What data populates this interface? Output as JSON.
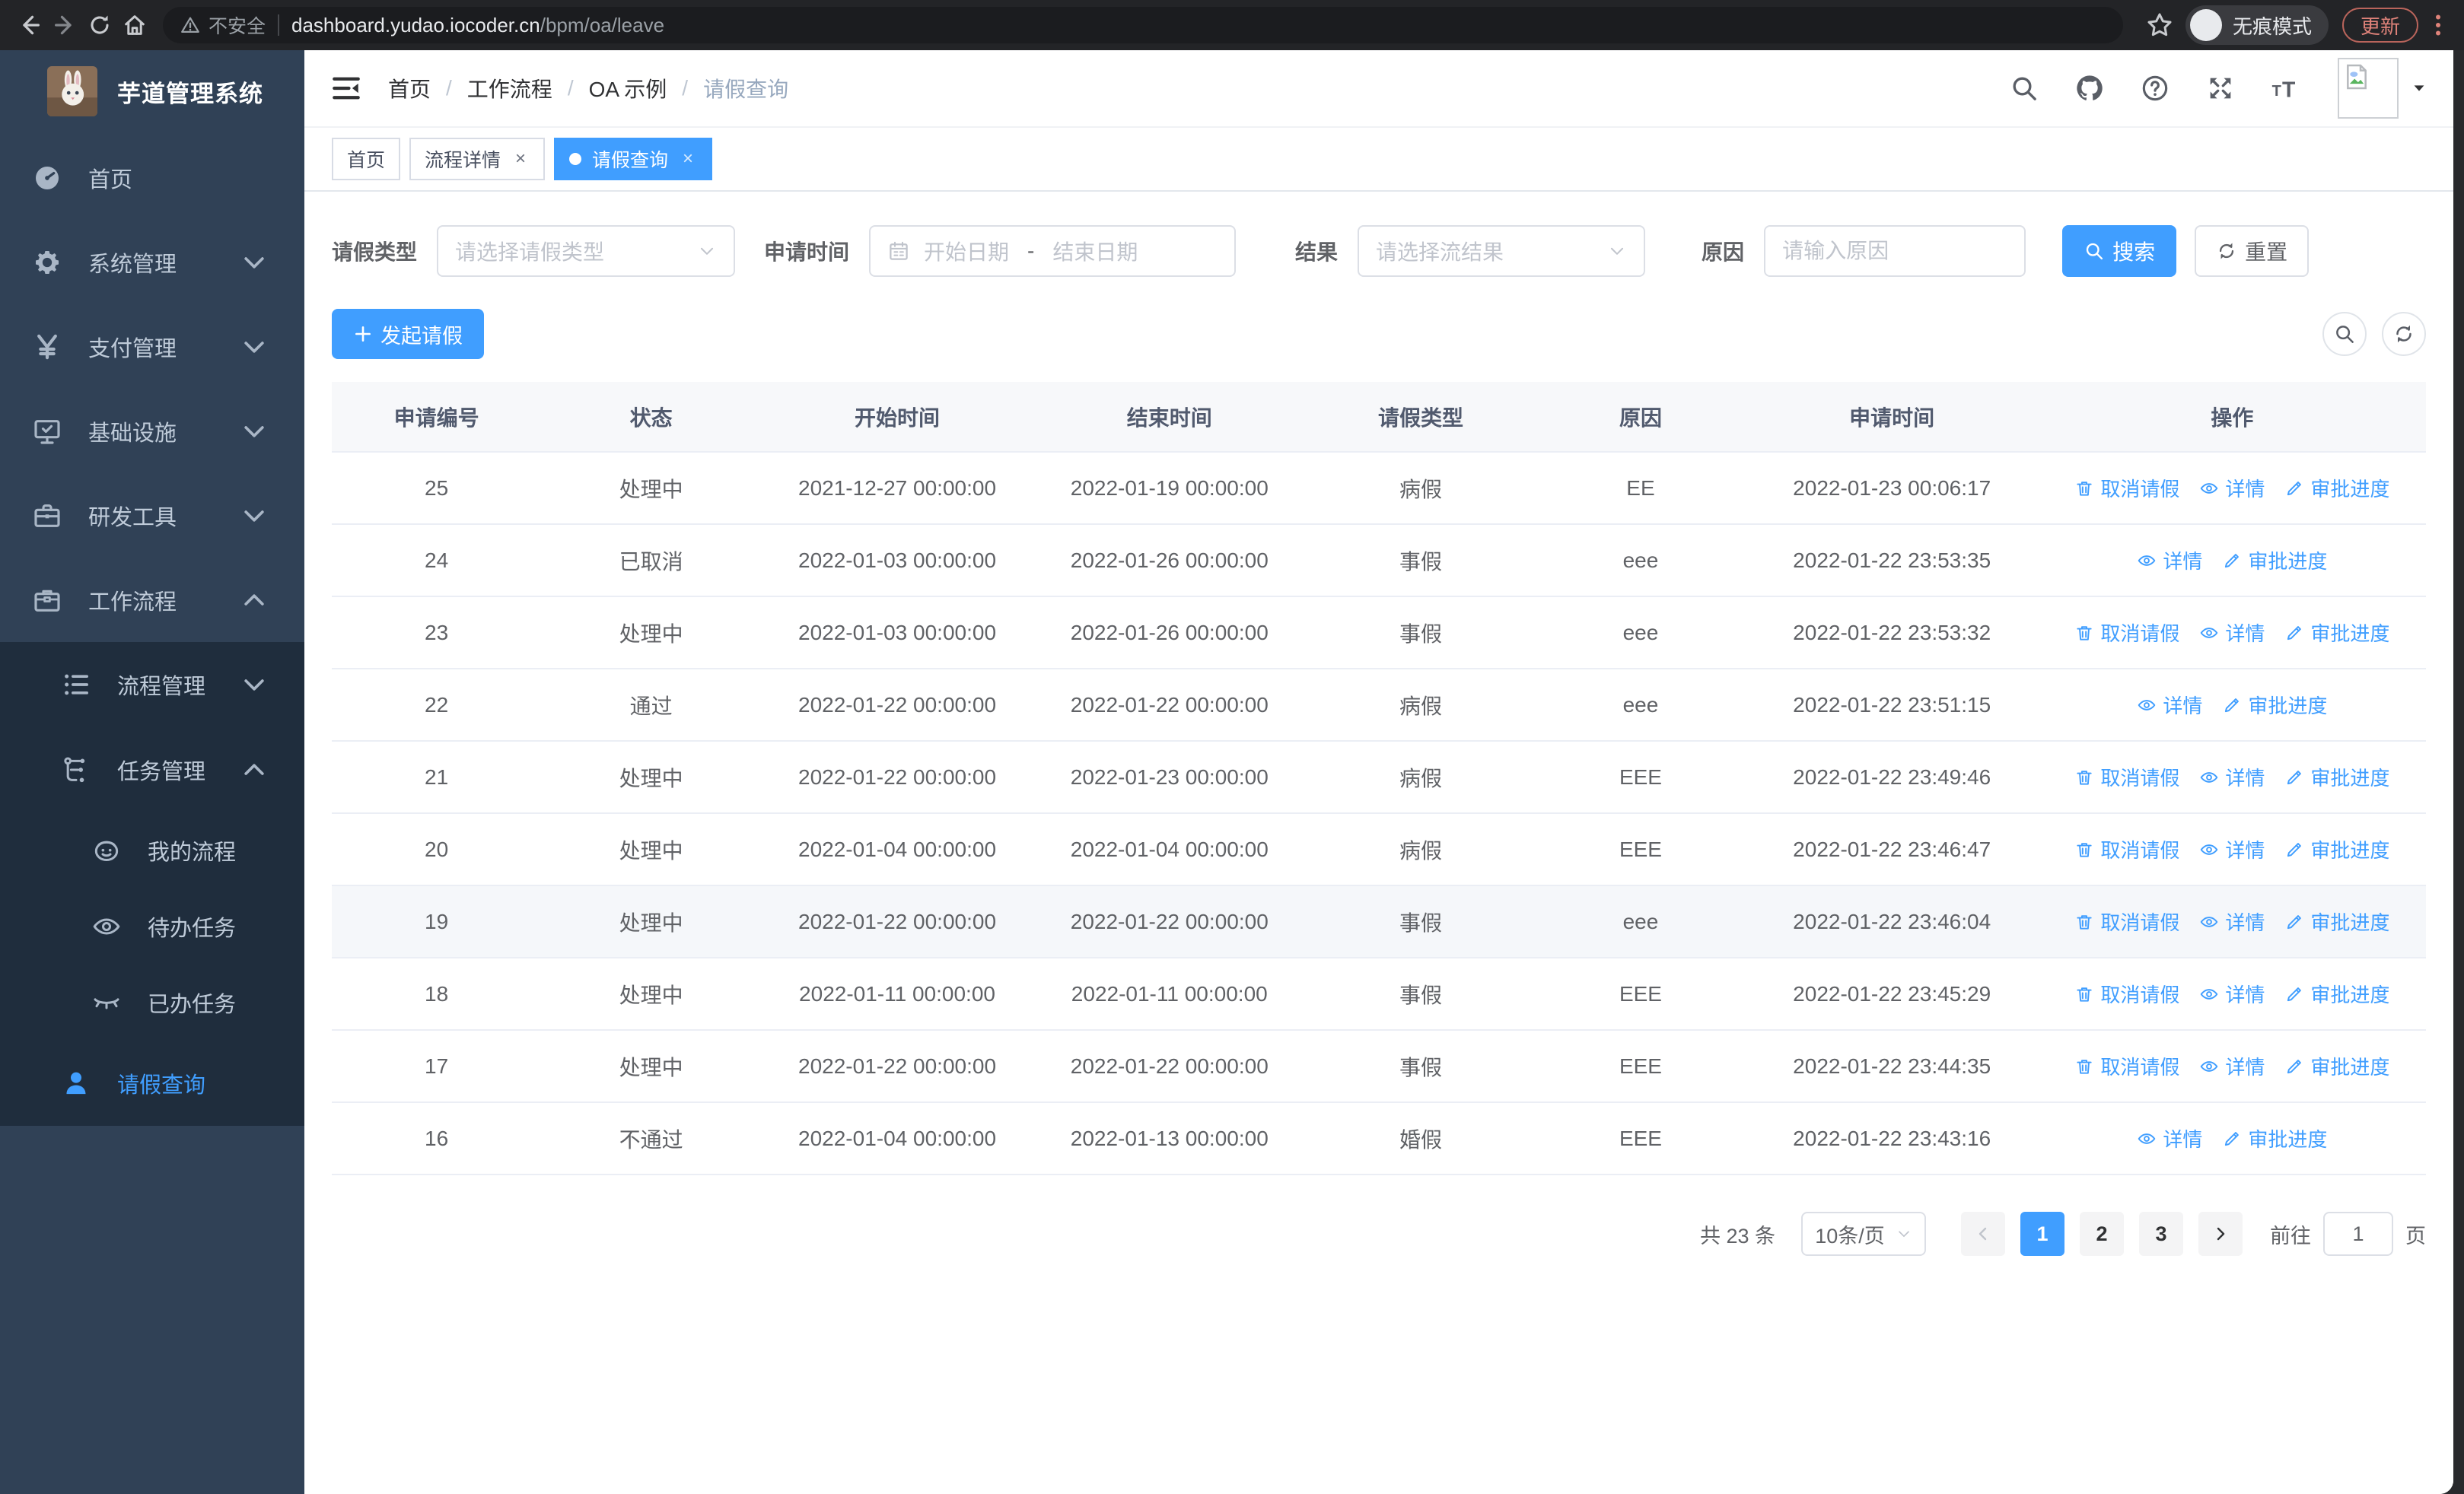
{
  "colors": {
    "primary": "#409eff",
    "sidebar_bg": "#304156",
    "submenu_bg": "#1f2d3d",
    "update_accent": "#e0837a"
  },
  "browser": {
    "security_label": "不安全",
    "url_host": "dashboard.yudao.iocoder.cn",
    "url_path": "/bpm/oa/leave",
    "incognito_label": "无痕模式",
    "update_label": "更新"
  },
  "sidebar": {
    "title": "芋道管理系统",
    "menu": [
      {
        "key": "home",
        "icon": "dashboard-icon",
        "label": "首页",
        "level": 1
      },
      {
        "key": "system-management",
        "icon": "gear-icon",
        "label": "系统管理",
        "level": 1,
        "chevron": "down"
      },
      {
        "key": "payment-management",
        "icon": "yen-icon",
        "label": "支付管理",
        "level": 1,
        "chevron": "down"
      },
      {
        "key": "infrastructure",
        "icon": "monitor-icon",
        "label": "基础设施",
        "level": 1,
        "chevron": "down"
      },
      {
        "key": "dev-tools",
        "icon": "toolbox-icon",
        "label": "研发工具",
        "level": 1,
        "chevron": "down"
      },
      {
        "key": "workflow",
        "icon": "briefcase-icon",
        "label": "工作流程",
        "level": 1,
        "chevron": "up"
      },
      {
        "key": "process-management",
        "icon": "tree-list-icon",
        "label": "流程管理",
        "level": 2,
        "chevron": "down",
        "submenu": true
      },
      {
        "key": "task-management",
        "icon": "flow-icon",
        "label": "任务管理",
        "level": 2,
        "chevron": "up",
        "submenu": true
      },
      {
        "key": "my-process",
        "icon": "robot-face-icon",
        "label": "我的流程",
        "level": 3,
        "submenu": true
      },
      {
        "key": "todo-tasks",
        "icon": "eye-icon",
        "label": "待办任务",
        "level": 3,
        "submenu": true
      },
      {
        "key": "done-tasks",
        "icon": "eye-closed-icon",
        "label": "已办任务",
        "level": 3,
        "submenu": true
      },
      {
        "key": "leave-query",
        "icon": "user-icon",
        "label": "请假查询",
        "level": 2,
        "submenu": true,
        "active": true
      }
    ]
  },
  "navbar": {
    "breadcrumb": [
      "首页",
      "工作流程",
      "OA 示例",
      "请假查询"
    ]
  },
  "tabs": [
    {
      "key": "home",
      "label": "首页"
    },
    {
      "key": "process-detail",
      "label": "流程详情",
      "closable": true
    },
    {
      "key": "leave-query",
      "label": "请假查询",
      "closable": true,
      "active": true
    }
  ],
  "filters": {
    "leave_type": {
      "label": "请假类型",
      "placeholder": "请选择请假类型"
    },
    "apply_time": {
      "label": "申请时间",
      "start_placeholder": "开始日期",
      "separator": "-",
      "end_placeholder": "结束日期"
    },
    "result": {
      "label": "结果",
      "placeholder": "请选择流结果"
    },
    "reason": {
      "label": "原因",
      "placeholder": "请输入原因"
    },
    "search_label": "搜索",
    "reset_label": "重置"
  },
  "toolbar": {
    "create_label": "发起请假"
  },
  "table": {
    "columns": [
      "申请编号",
      "状态",
      "开始时间",
      "结束时间",
      "请假类型",
      "原因",
      "申请时间",
      "操作"
    ],
    "action_labels": {
      "cancel": "取消请假",
      "detail": "详情",
      "progress": "审批进度"
    },
    "rows": [
      {
        "id": "25",
        "status": "处理中",
        "start": "2021-12-27 00:00:00",
        "end": "2022-01-19 00:00:00",
        "type": "病假",
        "reason": "EE",
        "applied": "2022-01-23 00:06:17",
        "actions": [
          "cancel",
          "detail",
          "progress"
        ]
      },
      {
        "id": "24",
        "status": "已取消",
        "start": "2022-01-03 00:00:00",
        "end": "2022-01-26 00:00:00",
        "type": "事假",
        "reason": "eee",
        "applied": "2022-01-22 23:53:35",
        "actions": [
          "detail",
          "progress"
        ]
      },
      {
        "id": "23",
        "status": "处理中",
        "start": "2022-01-03 00:00:00",
        "end": "2022-01-26 00:00:00",
        "type": "事假",
        "reason": "eee",
        "applied": "2022-01-22 23:53:32",
        "actions": [
          "cancel",
          "detail",
          "progress"
        ]
      },
      {
        "id": "22",
        "status": "通过",
        "start": "2022-01-22 00:00:00",
        "end": "2022-01-22 00:00:00",
        "type": "病假",
        "reason": "eee",
        "applied": "2022-01-22 23:51:15",
        "actions": [
          "detail",
          "progress"
        ]
      },
      {
        "id": "21",
        "status": "处理中",
        "start": "2022-01-22 00:00:00",
        "end": "2022-01-23 00:00:00",
        "type": "病假",
        "reason": "EEE",
        "applied": "2022-01-22 23:49:46",
        "actions": [
          "cancel",
          "detail",
          "progress"
        ]
      },
      {
        "id": "20",
        "status": "处理中",
        "start": "2022-01-04 00:00:00",
        "end": "2022-01-04 00:00:00",
        "type": "病假",
        "reason": "EEE",
        "applied": "2022-01-22 23:46:47",
        "actions": [
          "cancel",
          "detail",
          "progress"
        ]
      },
      {
        "id": "19",
        "status": "处理中",
        "start": "2022-01-22 00:00:00",
        "end": "2022-01-22 00:00:00",
        "type": "事假",
        "reason": "eee",
        "applied": "2022-01-22 23:46:04",
        "actions": [
          "cancel",
          "detail",
          "progress"
        ],
        "highlighted": true
      },
      {
        "id": "18",
        "status": "处理中",
        "start": "2022-01-11 00:00:00",
        "end": "2022-01-11 00:00:00",
        "type": "事假",
        "reason": "EEE",
        "applied": "2022-01-22 23:45:29",
        "actions": [
          "cancel",
          "detail",
          "progress"
        ]
      },
      {
        "id": "17",
        "status": "处理中",
        "start": "2022-01-22 00:00:00",
        "end": "2022-01-22 00:00:00",
        "type": "事假",
        "reason": "EEE",
        "applied": "2022-01-22 23:44:35",
        "actions": [
          "cancel",
          "detail",
          "progress"
        ]
      },
      {
        "id": "16",
        "status": "不通过",
        "start": "2022-01-04 00:00:00",
        "end": "2022-01-13 00:00:00",
        "type": "婚假",
        "reason": "EEE",
        "applied": "2022-01-22 23:43:16",
        "actions": [
          "detail",
          "progress"
        ]
      }
    ]
  },
  "pagination": {
    "total_label": "共 23 条",
    "page_size_label": "10条/页",
    "pages": [
      "1",
      "2",
      "3"
    ],
    "current_page": "1",
    "goto_label": "前往",
    "goto_value": "1",
    "goto_unit": "页"
  }
}
